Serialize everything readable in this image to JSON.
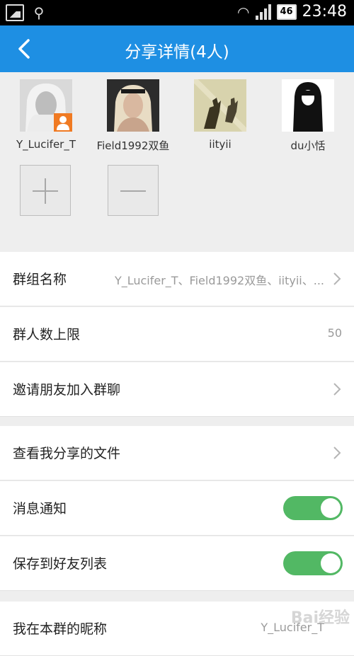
{
  "status_bar": {
    "battery": "46",
    "time": "23:48"
  },
  "header": {
    "title": "分享详情(4人)"
  },
  "members": [
    {
      "name": "Y_Lucifer_T",
      "is_owner": true
    },
    {
      "name": "Field1992双鱼"
    },
    {
      "name": "iityii"
    },
    {
      "name": "du小恬"
    }
  ],
  "actions": {
    "add": "add-member",
    "remove": "remove-member"
  },
  "settings": {
    "group_name": {
      "label": "群组名称",
      "value": "Y_Lucifer_T、Field1992双鱼、iityii、..."
    },
    "member_limit": {
      "label": "群人数上限",
      "value": "50"
    },
    "invite": {
      "label": "邀请朋友加入群聊"
    },
    "my_files": {
      "label": "查看我分享的文件"
    },
    "notify": {
      "label": "消息通知",
      "on": true
    },
    "save_contacts": {
      "label": "保存到好友列表",
      "on": true
    },
    "nickname": {
      "label": "我在本群的昵称",
      "value": "Y_Lucifer_T"
    }
  },
  "colors": {
    "header": "#1e8fe3",
    "toggle_on": "#52b864",
    "owner_badge": "#f07a22"
  },
  "watermark": "Bai经验"
}
